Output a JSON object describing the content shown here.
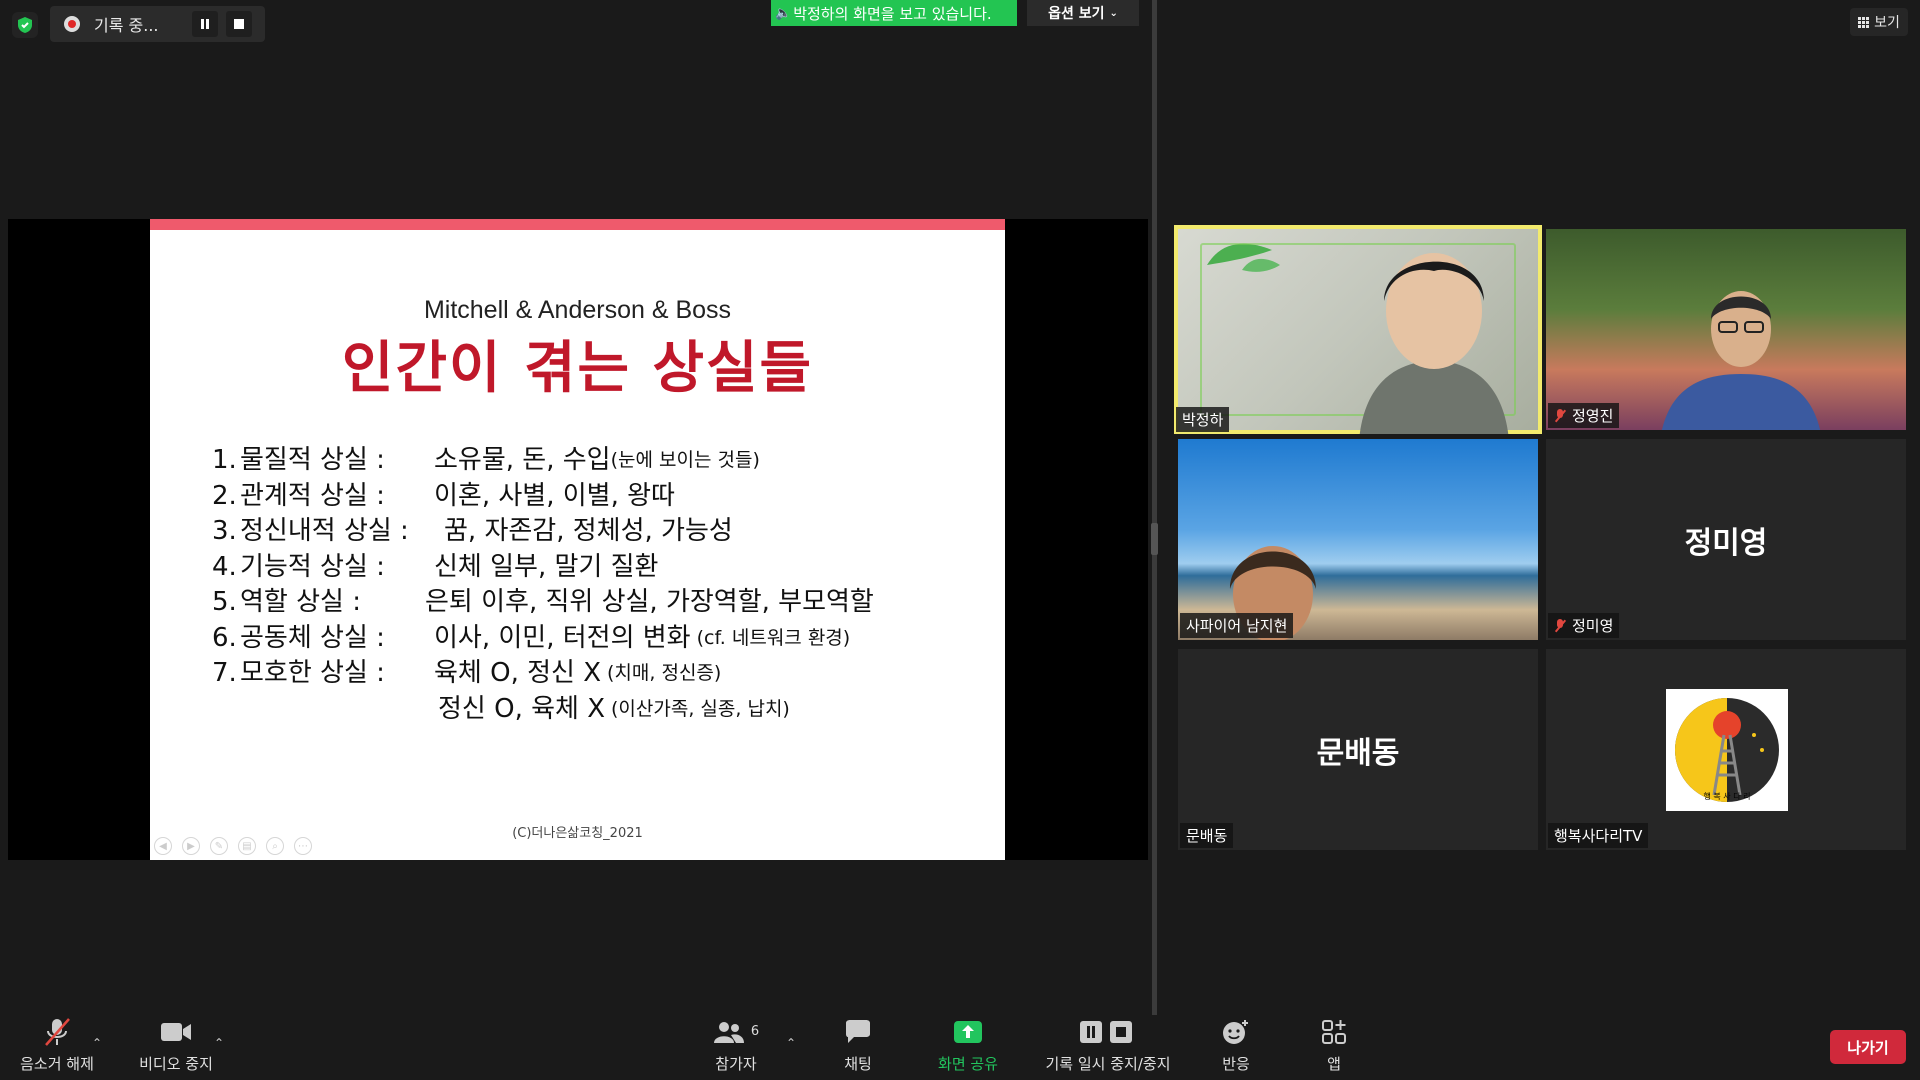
{
  "recording": {
    "status_label": "기록 중..."
  },
  "banner": {
    "viewing_text": "박정하의 화면을 보고 있습니다.",
    "options_label": "옵션 보기"
  },
  "view_button": {
    "label": "보기"
  },
  "slide": {
    "subtitle": "Mitchell & Anderson & Boss",
    "title": "인간이 겪는 상실들",
    "items": [
      {
        "num": "1.",
        "head": "물질적 상실 :",
        "body": "소유물, 돈, 수입",
        "small": "(눈에 보이는 것들)"
      },
      {
        "num": "2.",
        "head": "관계적 상실 :",
        "body": "이혼, 사별, 이별, 왕따",
        "small": ""
      },
      {
        "num": "3.",
        "head": "정신내적 상실 :",
        "body": "꿈, 자존감, 정체성, 가능성",
        "small": ""
      },
      {
        "num": "4.",
        "head": "기능적 상실 :",
        "body": "신체 일부, 말기 질환",
        "small": ""
      },
      {
        "num": "5.",
        "head": "역할 상실 :",
        "body": "은퇴 이후, 직위 상실, 가장역할, 부모역할",
        "small": ""
      },
      {
        "num": "6.",
        "head": "공동체 상실 :",
        "body": "이사, 이민, 터전의 변화",
        "small": "(cf. 네트워크 환경)"
      },
      {
        "num": "7.",
        "head": "모호한 상실 :",
        "body": "육체 O, 정신 X",
        "small": "(치매, 정신증)"
      }
    ],
    "item7_line2": {
      "body": "정신 O, 육체 X",
      "small": "(이산가족, 실종, 납치)"
    },
    "footer": "(C)더나은삶코칭_2021",
    "accent_color": "#ef5a6c",
    "title_color": "#c0182a"
  },
  "participants": [
    {
      "name": "박정하",
      "muted": false,
      "video": true,
      "active": true
    },
    {
      "name": "정영진",
      "muted": true,
      "video": true,
      "active": false
    },
    {
      "name": "사파이어 남지현",
      "muted": false,
      "video": true,
      "active": false
    },
    {
      "name": "정미영",
      "muted": true,
      "video": false,
      "active": false,
      "big_name": "정미영"
    },
    {
      "name": "문배동",
      "muted": false,
      "video": false,
      "active": false,
      "big_name": "문배동"
    },
    {
      "name": "행복사다리TV",
      "muted": false,
      "video": false,
      "active": false,
      "logo_text": "행 복 사 다 리"
    }
  ],
  "toolbar": {
    "unmute_label": "음소거 해제",
    "stop_video_label": "비디오 중지",
    "participants_label": "참가자",
    "participants_count": "6",
    "chat_label": "채팅",
    "share_label": "화면 공유",
    "pause_record_label": "기록 일시 중지/중지",
    "reactions_label": "반응",
    "apps_label": "앱",
    "leave_label": "나가기"
  },
  "colors": {
    "share_green": "#22c55e",
    "leave_red": "#d0293b",
    "active_speaker": "#f2ea6d",
    "banner_green": "#23c552"
  }
}
